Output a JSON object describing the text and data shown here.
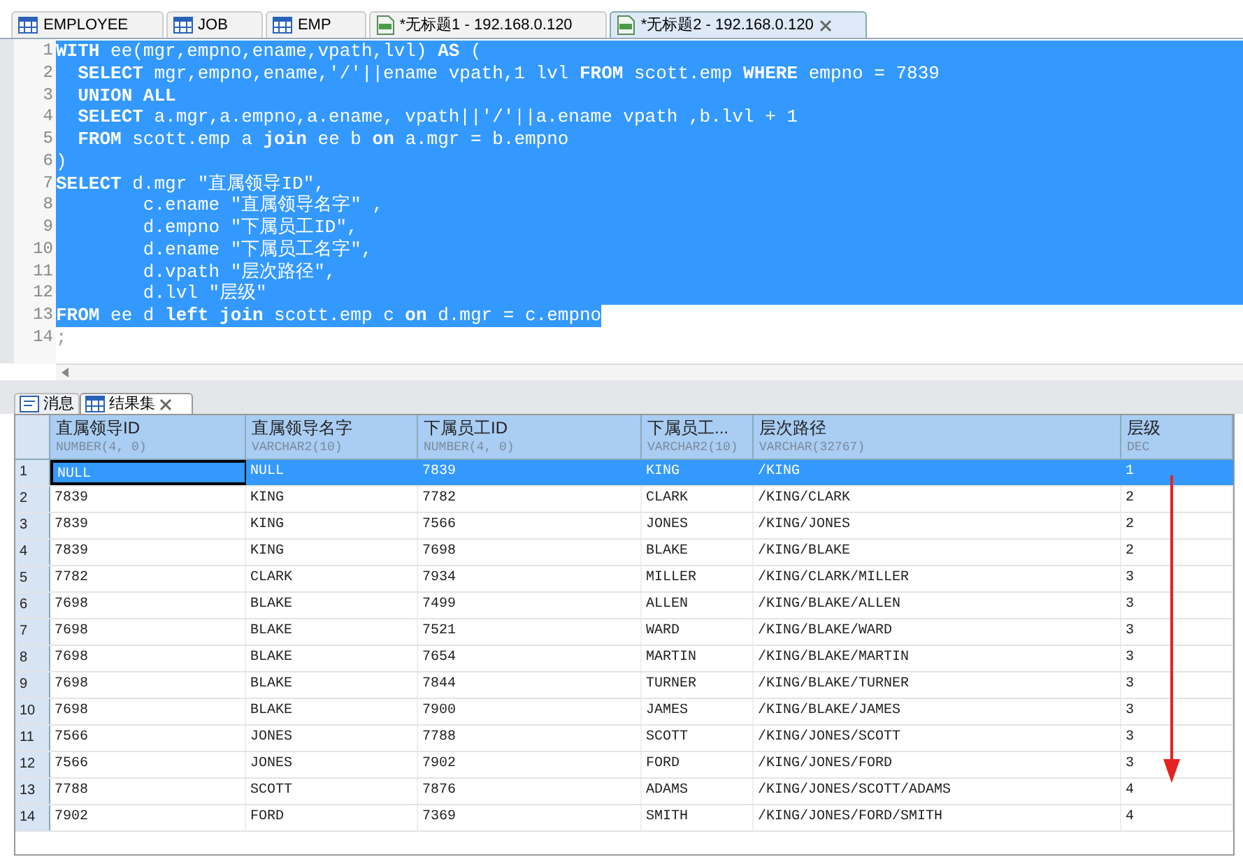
{
  "editor_tabs": [
    {
      "label": "EMPLOYEE",
      "kind": "table",
      "selected": false,
      "closable": false
    },
    {
      "label": "JOB",
      "kind": "table",
      "selected": false,
      "closable": false
    },
    {
      "label": "EMP",
      "kind": "table",
      "selected": false,
      "closable": false
    },
    {
      "label": "*无标题1 - 192.168.0.120",
      "kind": "sql",
      "selected": false,
      "closable": false
    },
    {
      "label": "*无标题2 - 192.168.0.120",
      "kind": "sql",
      "selected": true,
      "closable": true
    }
  ],
  "code_lines": [
    {
      "number": "1",
      "text": "**WITH** ee(mgr,empno,ename,vpath,lvl) **AS** (",
      "selected": true
    },
    {
      "number": "2",
      "text": "  **SELECT** mgr,empno,ename,'/'||ename vpath,1 lvl **FROM** scott.emp **WHERE** empno = 7839",
      "selected": true
    },
    {
      "number": "3",
      "text": "  **UNION ALL**",
      "selected": true
    },
    {
      "number": "4",
      "text": "  **SELECT** a.mgr,a.empno,a.ename, vpath||'/'||a.ename vpath ,b.lvl + 1",
      "selected": true
    },
    {
      "number": "5",
      "text": "  **FROM** scott.emp a **join** ee b **on** a.mgr = b.empno",
      "selected": true
    },
    {
      "number": "6",
      "text": ")",
      "selected": true
    },
    {
      "number": "7",
      "text": "**SELECT** d.mgr \"直属领导ID\",",
      "selected": true
    },
    {
      "number": "8",
      "text": "        c.ename \"直属领导名字\" ,",
      "selected": true
    },
    {
      "number": "9",
      "text": "        d.empno \"下属员工ID\",",
      "selected": true
    },
    {
      "number": "10",
      "text": "        d.ename \"下属员工名字\",",
      "selected": true
    },
    {
      "number": "11",
      "text": "        d.vpath \"层次路径\",",
      "selected": true
    },
    {
      "number": "12",
      "text": "        d.lvl \"层级\"",
      "selected": true
    },
    {
      "number": "13",
      "text": "**FROM** ee d **left join** scott.emp c **on** d.mgr = c.empno",
      "selected": true,
      "partial": true
    },
    {
      "number": "14",
      "text": ";",
      "selected": false
    }
  ],
  "result_tabs": [
    {
      "label": "消息",
      "kind": "messages",
      "selected": false,
      "closable": false
    },
    {
      "label": "结果集",
      "kind": "table",
      "selected": true,
      "closable": true
    }
  ],
  "table": {
    "columns": [
      {
        "name": "直属领导ID",
        "type": "NUMBER(4, 0)"
      },
      {
        "name": "直属领导名字",
        "type": "VARCHAR2(10)"
      },
      {
        "name": "下属员工ID",
        "type": "NUMBER(4, 0)"
      },
      {
        "name": "下属员工...",
        "type": "VARCHAR2(10)"
      },
      {
        "name": "层次路径",
        "type": "VARCHAR(32767)"
      },
      {
        "name": "层级",
        "type": "DEC"
      }
    ],
    "rows": [
      {
        "number": "1",
        "selected": true,
        "cells": [
          "NULL",
          "NULL",
          "7839",
          "KING",
          "/KING",
          "1"
        ]
      },
      {
        "number": "2",
        "selected": false,
        "cells": [
          "7839",
          "KING",
          "7782",
          "CLARK",
          "/KING/CLARK",
          "2"
        ]
      },
      {
        "number": "3",
        "selected": false,
        "cells": [
          "7839",
          "KING",
          "7566",
          "JONES",
          "/KING/JONES",
          "2"
        ]
      },
      {
        "number": "4",
        "selected": false,
        "cells": [
          "7839",
          "KING",
          "7698",
          "BLAKE",
          "/KING/BLAKE",
          "2"
        ]
      },
      {
        "number": "5",
        "selected": false,
        "cells": [
          "7782",
          "CLARK",
          "7934",
          "MILLER",
          "/KING/CLARK/MILLER",
          "3"
        ]
      },
      {
        "number": "6",
        "selected": false,
        "cells": [
          "7698",
          "BLAKE",
          "7499",
          "ALLEN",
          "/KING/BLAKE/ALLEN",
          "3"
        ]
      },
      {
        "number": "7",
        "selected": false,
        "cells": [
          "7698",
          "BLAKE",
          "7521",
          "WARD",
          "/KING/BLAKE/WARD",
          "3"
        ]
      },
      {
        "number": "8",
        "selected": false,
        "cells": [
          "7698",
          "BLAKE",
          "7654",
          "MARTIN",
          "/KING/BLAKE/MARTIN",
          "3"
        ]
      },
      {
        "number": "9",
        "selected": false,
        "cells": [
          "7698",
          "BLAKE",
          "7844",
          "TURNER",
          "/KING/BLAKE/TURNER",
          "3"
        ]
      },
      {
        "number": "10",
        "selected": false,
        "cells": [
          "7698",
          "BLAKE",
          "7900",
          "JAMES",
          "/KING/BLAKE/JAMES",
          "3"
        ]
      },
      {
        "number": "11",
        "selected": false,
        "cells": [
          "7566",
          "JONES",
          "7788",
          "SCOTT",
          "/KING/JONES/SCOTT",
          "3"
        ]
      },
      {
        "number": "12",
        "selected": false,
        "cells": [
          "7566",
          "JONES",
          "7902",
          "FORD",
          "/KING/JONES/FORD",
          "3"
        ]
      },
      {
        "number": "13",
        "selected": false,
        "cells": [
          "7788",
          "SCOTT",
          "7876",
          "ADAMS",
          "/KING/JONES/SCOTT/ADAMS",
          "4"
        ]
      },
      {
        "number": "14",
        "selected": false,
        "cells": [
          "7902",
          "FORD",
          "7369",
          "SMITH",
          "/KING/JONES/FORD/SMITH",
          "4"
        ]
      }
    ]
  }
}
